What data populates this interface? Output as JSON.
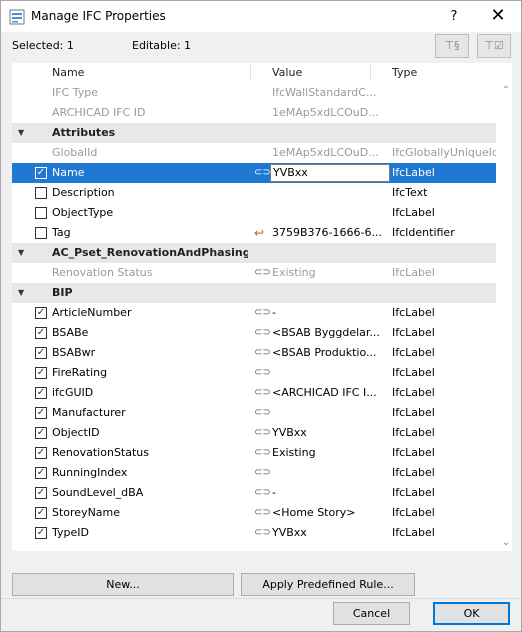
{
  "window": {
    "title": "Manage IFC Properties",
    "help": "?",
    "close": "✕"
  },
  "info": {
    "selected": "Selected: 1",
    "editable": "Editable: 1"
  },
  "filters": {
    "filter1": "⊤§",
    "filter2": "⊤☑"
  },
  "columns": {
    "name": "Name",
    "value": "Value",
    "type": "Type"
  },
  "rows": [
    {
      "kind": "info",
      "name": "IFC Type",
      "value": "IfcWallStandardC...",
      "type": ""
    },
    {
      "kind": "info",
      "name": "ARCHICAD IFC ID",
      "value": "1eMAp5xdLCOuD...",
      "type": ""
    },
    {
      "kind": "group",
      "name": "Attributes"
    },
    {
      "kind": "prop",
      "name": "GlobalId",
      "value": "1eMAp5xdLCOuD...",
      "type": "IfcGloballyUniqueId",
      "gray": true,
      "check": "",
      "icon": ""
    },
    {
      "kind": "prop",
      "name": "Name",
      "value": "YVBxx",
      "type": "IfcLabel",
      "selected": true,
      "check": "✓",
      "icon": "⊂⊃"
    },
    {
      "kind": "prop",
      "name": "Description",
      "value": "",
      "type": "IfcText",
      "check": "",
      "icon": ""
    },
    {
      "kind": "prop",
      "name": "ObjectType",
      "value": "",
      "type": "IfcLabel",
      "check": "",
      "icon": ""
    },
    {
      "kind": "prop",
      "name": "Tag",
      "value": "3759B376-1666-6...",
      "type": "IfcIdentifier",
      "check": "",
      "icon": "tag"
    },
    {
      "kind": "group",
      "name": "AC_Pset_RenovationAndPhasing"
    },
    {
      "kind": "prop",
      "name": "Renovation Status",
      "value": "Existing",
      "type": "IfcLabel",
      "gray": true,
      "check": "",
      "icon": "⊂⊃",
      "nobox": true
    },
    {
      "kind": "group",
      "name": "BIP"
    },
    {
      "kind": "prop",
      "name": "ArticleNumber",
      "value": "-",
      "type": "IfcLabel",
      "check": "✓",
      "icon": "⊂⊃"
    },
    {
      "kind": "prop",
      "name": "BSABe",
      "value": "<BSAB Byggdelar...",
      "type": "IfcLabel",
      "check": "✓",
      "icon": "⊂⊃"
    },
    {
      "kind": "prop",
      "name": "BSABwr",
      "value": "<BSAB Produktio...",
      "type": "IfcLabel",
      "check": "✓",
      "icon": "⊂⊃"
    },
    {
      "kind": "prop",
      "name": "FireRating",
      "value": "",
      "type": "IfcLabel",
      "check": "✓",
      "icon": "⊂⊃"
    },
    {
      "kind": "prop",
      "name": "ifcGUID",
      "value": "<ARCHICAD IFC I...",
      "type": "IfcLabel",
      "check": "✓",
      "icon": "⊂⊃"
    },
    {
      "kind": "prop",
      "name": "Manufacturer",
      "value": "",
      "type": "IfcLabel",
      "check": "✓",
      "icon": "⊂⊃"
    },
    {
      "kind": "prop",
      "name": "ObjectID",
      "value": "YVBxx",
      "type": "IfcLabel",
      "check": "✓",
      "icon": "⊂⊃"
    },
    {
      "kind": "prop",
      "name": "RenovationStatus",
      "value": "Existing",
      "type": "IfcLabel",
      "check": "✓",
      "icon": "⊂⊃"
    },
    {
      "kind": "prop",
      "name": "RunningIndex",
      "value": "",
      "type": "IfcLabel",
      "check": "✓",
      "icon": "⊂⊃"
    },
    {
      "kind": "prop",
      "name": "SoundLevel_dBA",
      "value": "-",
      "type": "IfcLabel",
      "check": "✓",
      "icon": "⊂⊃"
    },
    {
      "kind": "prop",
      "name": "StoreyName",
      "value": "<Home Story>",
      "type": "IfcLabel",
      "check": "✓",
      "icon": "⊂⊃"
    },
    {
      "kind": "prop",
      "name": "TypeID",
      "value": "YVBxx",
      "type": "IfcLabel",
      "check": "✓",
      "icon": "⊂⊃"
    }
  ],
  "buttons": {
    "new": "New...",
    "apply_rule": "Apply Predefined Rule...",
    "cancel": "Cancel",
    "ok": "OK"
  },
  "colors": {
    "selection": "#1f78d1",
    "group_bg": "#e8e8e8",
    "ok_border": "#0078d7"
  }
}
